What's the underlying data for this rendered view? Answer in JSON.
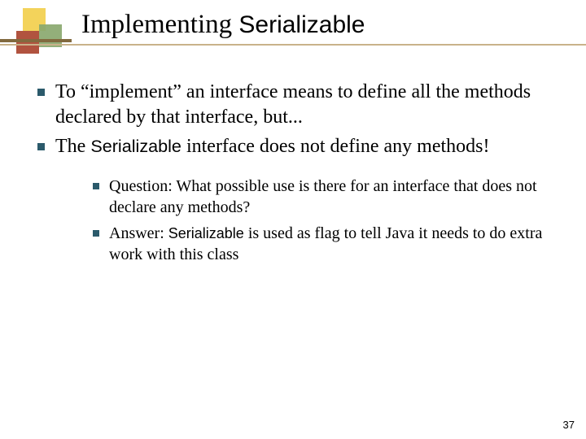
{
  "title": {
    "prefix": "Implementing ",
    "code": "Serializable"
  },
  "bullets": {
    "b1": "To “implement” an interface means to define all the methods declared by that interface, but...",
    "b2_a": "The ",
    "b2_code": "Serializable",
    "b2_b": " interface does not define any methods!",
    "s1": "Question: What possible use is there for an interface that does not declare any methods?",
    "s2_a": "Answer: ",
    "s2_code": "Serializable",
    "s2_b": " is used as flag to tell Java it needs to do extra work with this class"
  },
  "page_number": "37"
}
